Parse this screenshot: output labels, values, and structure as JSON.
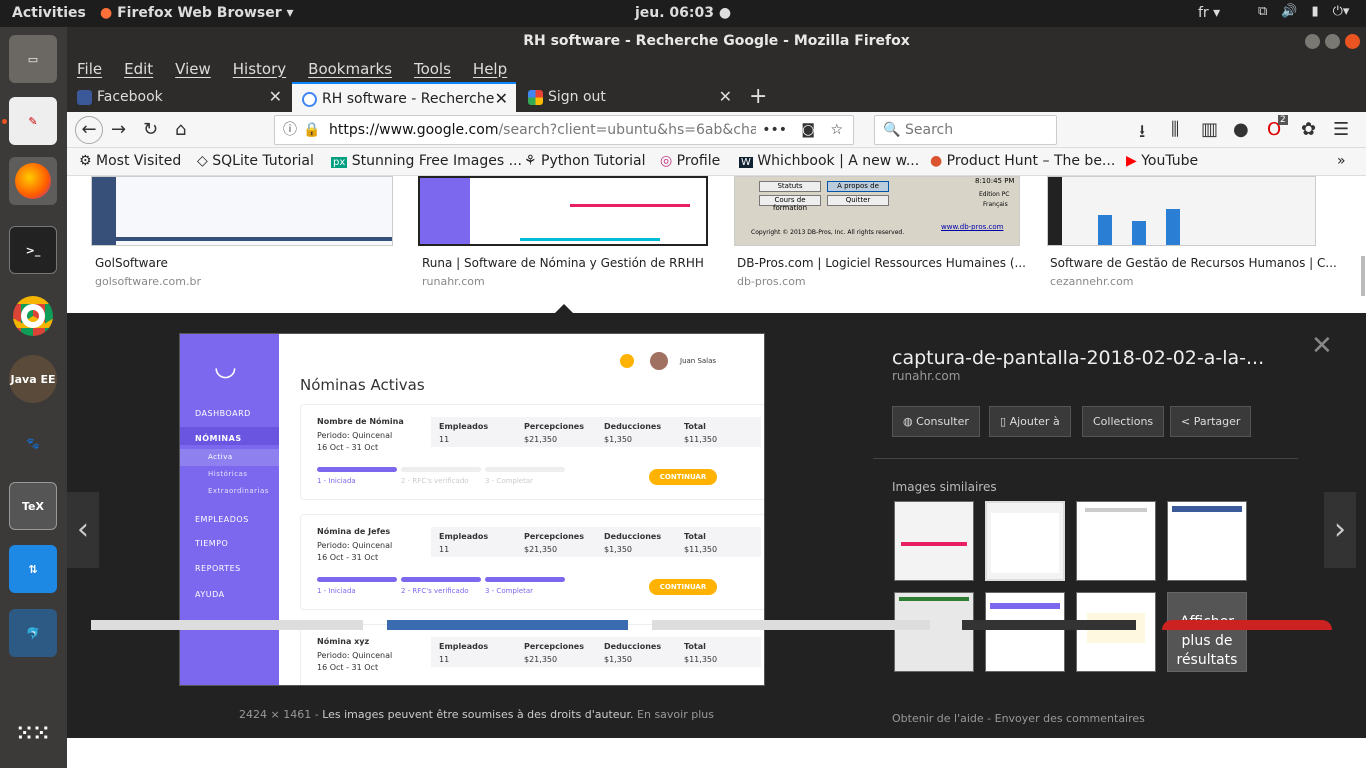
{
  "topbar": {
    "activities": "Activities",
    "app": "Firefox Web Browser ▾",
    "clock": "jeu. 06:03 ●",
    "lang": "fr ▾",
    "tray": [
      "⚡",
      "🔊",
      "⚙",
      "▾"
    ]
  },
  "window": {
    "title": "RH software - Recherche Google - Mozilla Firefox"
  },
  "menu": [
    "File",
    "Edit",
    "View",
    "History",
    "Bookmarks",
    "Tools",
    "Help"
  ],
  "tabs": [
    {
      "label": "Facebook",
      "color": "#3b5998"
    },
    {
      "label": "RH software - Recherche",
      "color": "#4285f4"
    },
    {
      "label": "Sign out",
      "color": "#e8453c"
    }
  ],
  "nav": {
    "url_host": "https://www.google.com",
    "url_rest": "/search?client=ubuntu&hs=6ab&chann",
    "search_placeholder": "Search",
    "badge": "2"
  },
  "bookmarks": [
    "Most Visited",
    "SQLite Tutorial",
    "Stunning Free Images ...",
    "Python Tutorial",
    "Profile",
    "Whichbook | A new w...",
    "Product Hunt – The be...",
    "YouTube"
  ],
  "results": [
    {
      "caption": "GolSoftware",
      "domain": "golsoftware.com.br"
    },
    {
      "caption": "Runa | Software de Nómina y Gestión de RRHH",
      "domain": "runahr.com"
    },
    {
      "caption": "DB-Pros.com | Logiciel Ressources Humaines (...",
      "domain": "db-pros.com"
    },
    {
      "caption": "Software de Gestão de Recursos Humanos | C...",
      "domain": "cezannehr.com"
    }
  ],
  "dbpros": {
    "buttons": [
      "Statuts",
      "A propos de",
      "Cours de formation",
      "Quitter"
    ],
    "copyright": "Copyright © 2013 DB-Pros, Inc. All rights reserved.",
    "link": "www.db-pros.com",
    "time": "8:10:45 PM",
    "edition": "Edition PC",
    "lang": "Français"
  },
  "preview": {
    "title": "captura-de-pantalla-2018-02-02-a-la-...",
    "domain": "runahr.com",
    "buttons": [
      "Consulter",
      "Ajouter à",
      "Collections",
      "Partager"
    ],
    "similar_label": "Images similaires",
    "more": "Afficher plus de résultats",
    "dims": "2424 × 1461",
    "sep": "-",
    "rights": "Les images peuvent être soumises à des droits d'auteur.",
    "learn": "En savoir plus",
    "help": "Obtenir de l'aide",
    "feedback": "Envoyer des commentaires"
  },
  "app": {
    "user": "Juan Salas",
    "heading": "Nóminas Activas",
    "sidebar": [
      "DASHBOARD",
      "NÓMINAS",
      "Activa",
      "Históricas",
      "Extraordinarias",
      "EMPLEADOS",
      "TIEMPO",
      "REPORTES",
      "AYUDA"
    ],
    "cards": [
      {
        "name": "Nombre de Nómina",
        "period": "Periodo: Quincenal",
        "dates": "16 Oct - 31 Oct",
        "steps": [
          "1 - Iniciada",
          "2 - RFC's verificado",
          "3 - Completar"
        ],
        "done": 1,
        "button": "CONTINUAR"
      },
      {
        "name": "Nómina de Jefes",
        "period": "Periodo: Quincenal",
        "dates": "16 Oct - 31 Oct",
        "steps": [
          "1 - Iniciada",
          "2 - RFC's verificado",
          "3 - Completar"
        ],
        "done": 3,
        "button": "CONTINUAR"
      },
      {
        "name": "Nómina xyz",
        "period": "Periodo: Quincenal",
        "dates": "16 Oct - 31 Oct",
        "steps": [],
        "done": 0,
        "button": ""
      }
    ],
    "cols": [
      "Empleados",
      "Percepciones",
      "Deducciones",
      "Total"
    ],
    "vals": [
      "11",
      "$21,350",
      "$1,350",
      "$11,350"
    ]
  },
  "colors": {
    "accent": "#7b68ee",
    "orange": "#ffb300",
    "link": "#0a84ff"
  }
}
